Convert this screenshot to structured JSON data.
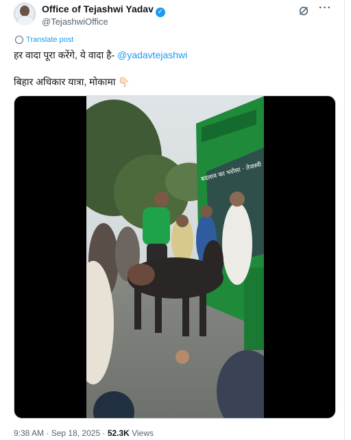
{
  "post": {
    "author_name": "Office of Tejashwi Yadav",
    "verified_mark": "✓",
    "author_handle": "@TejashwiOffice",
    "translate_label": "Translate post",
    "text_main": "हर वादा पूरा करेंगे, ये वादा है- ",
    "mention": "@yadavtejashwi",
    "text_location": "बिहार अधिकार यात्रा, मोकामा",
    "emoji": "👇🏻"
  },
  "media": {
    "type": "video",
    "bus_sign": "बदलाव का भरोसा · तेजस्वी"
  },
  "footer": {
    "time": "9:38 AM",
    "separator": "·",
    "date": "Sep 18, 2025",
    "views_count": "52.3K",
    "views_label": "Views"
  },
  "icons": {
    "verified": "verified-badge-icon",
    "grok": "grok-icon",
    "more": "more-options-icon",
    "translate": "globe-icon"
  },
  "colors": {
    "accent": "#1d9bf0",
    "text": "#0f1419",
    "secondary": "#536471"
  }
}
